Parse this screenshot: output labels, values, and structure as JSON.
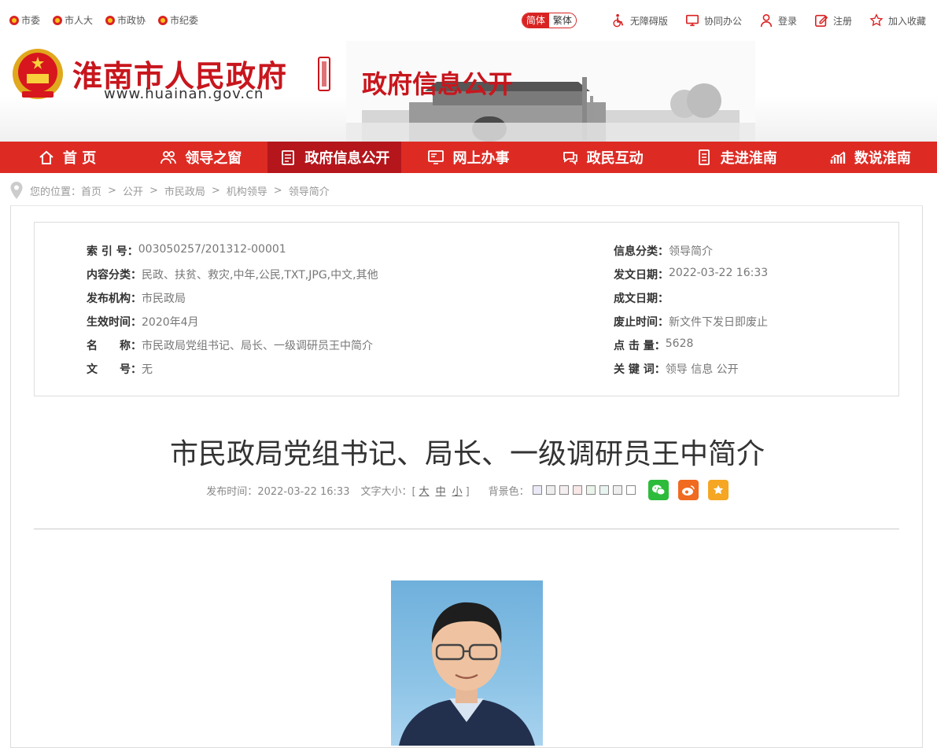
{
  "topbar": {
    "links": [
      "市委",
      "市人大",
      "市政协",
      "市纪委"
    ],
    "lang_simplified": "简体",
    "lang_traditional": "繁体",
    "tools": [
      "无障碍版",
      "协同办公",
      "登录",
      "注册",
      "加入收藏"
    ]
  },
  "header": {
    "site_name": "淮南市人民政府",
    "site_url": "www.huainan.gov.cn",
    "channel_title": "政府信息公开"
  },
  "nav": {
    "items": [
      "首 页",
      "领导之窗",
      "政府信息公开",
      "网上办事",
      "政民互动",
      "走进淮南",
      "数说淮南"
    ],
    "active_index": 2
  },
  "breadcrumb": {
    "prefix": "您的位置：",
    "items": [
      "首页",
      "公开",
      "市民政局",
      "机构领导",
      "领导简介"
    ],
    "separator": ">"
  },
  "meta": {
    "left": [
      {
        "k": "索 引 号：",
        "v": "003050257/201312-00001"
      },
      {
        "k": "内容分类：",
        "v": "民政、扶贫、救灾,中年,公民,TXT,JPG,中文,其他"
      },
      {
        "k": "发布机构：",
        "v": "市民政局"
      },
      {
        "k": "生效时间：",
        "v": "2020年4月"
      },
      {
        "k": "名　　称：",
        "v": "市民政局党组书记、局长、一级调研员王中简介"
      },
      {
        "k": "文　　号：",
        "v": "无"
      }
    ],
    "right": [
      {
        "k": "信息分类：",
        "v": "领导简介"
      },
      {
        "k": "发文日期：",
        "v": "2022-03-22 16:33"
      },
      {
        "k": "成文日期：",
        "v": ""
      },
      {
        "k": "废止时间：",
        "v": "新文件下发日即废止"
      },
      {
        "k": "点 击 量：",
        "v": "5628"
      },
      {
        "k": "关 键 词：",
        "v": "领导 信息 公开"
      }
    ]
  },
  "article": {
    "title": "市民政局党组书记、局长、一级调研员王中简介",
    "publish_label": "发布时间：",
    "publish_time": "2022-03-22 16:33",
    "font_size_label": "文字大小：[",
    "font_sizes": [
      "大",
      "中",
      "小"
    ],
    "font_size_end": "]",
    "bg_label": "背景色：",
    "bg_colors": [
      "#e9e9f7",
      "#eeeeee",
      "#f5eef0",
      "#f9e6e6",
      "#eaf4ea",
      "#e8f4f0",
      "#eeeeee",
      "#ffffff"
    ]
  },
  "colors": {
    "brand_red": "#dd2b24",
    "nav_active": "#b4161b",
    "wechat": "#2dbb3b",
    "weibo": "#f06a20",
    "favorite": "#f5a623"
  }
}
